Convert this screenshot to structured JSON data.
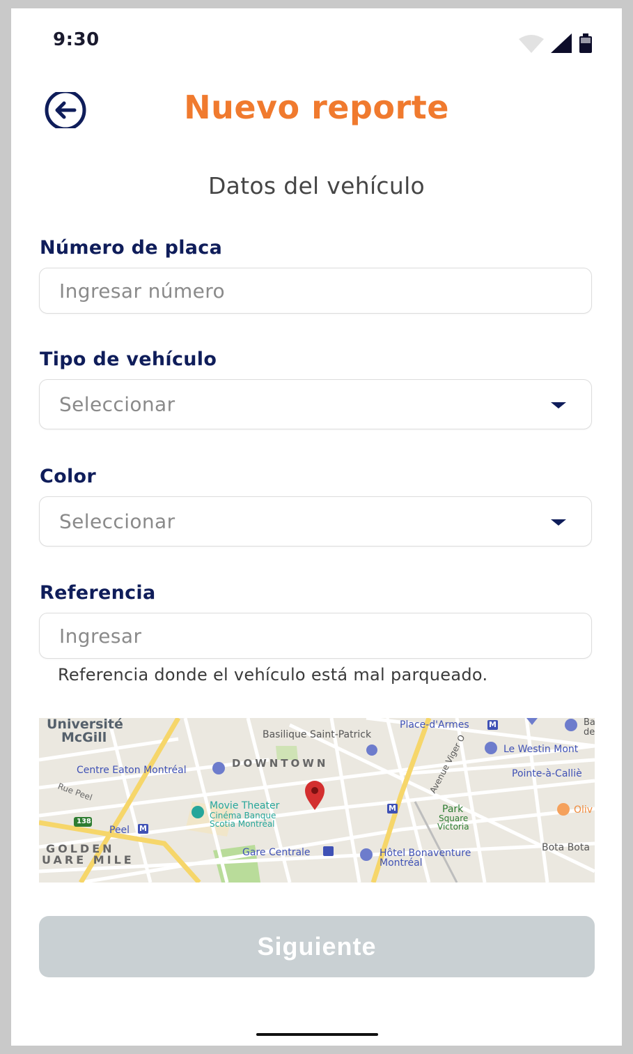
{
  "status_bar": {
    "time": "9:30",
    "icons": [
      "wifi-icon",
      "signal-icon",
      "battery-icon"
    ]
  },
  "header": {
    "back_icon": "back-arrow-circle-icon",
    "title": "Nuevo reporte",
    "title_color": "#f07a2e"
  },
  "section": {
    "title": "Datos del vehículo"
  },
  "form": {
    "plate": {
      "label": "Número de placa",
      "placeholder": "Ingresar número",
      "value": ""
    },
    "vehicle_type": {
      "label": "Tipo de vehículo",
      "selected": "Seleccionar"
    },
    "color": {
      "label": "Color",
      "selected": "Seleccionar"
    },
    "reference": {
      "label": "Referencia",
      "placeholder": "Ingresar",
      "value": "",
      "helper": "Referencia donde el vehículo está mal parqueado."
    }
  },
  "map": {
    "labels": {
      "universite": "Université",
      "mcgill": "McGill",
      "basilique": "Basilique Saint-Patrick",
      "place_darmes": "Place-d'Armes",
      "downtown": "DOWNTOWN",
      "centre_eaton": "Centre Eaton Montréal",
      "le_westin": "Le Westin Mont",
      "pointe": "Pointe-à-Calliè",
      "rue_peel": "Rue Peel",
      "movie_theater": "Movie Theater",
      "cinema1": "Cinéma Banque",
      "cinema2": "Scotia Montréal",
      "park": "Park",
      "square": "Square",
      "victoria": "Victoria",
      "peel": "Peel",
      "route_138": "138",
      "golden": "GOLDEN",
      "square_mile": "UARE MILE",
      "gare_centrale": "Gare Centrale",
      "hotel1": "Hôtel Bonaventure",
      "hotel2": "Montréal",
      "bota": "Bota Bota",
      "avenue_viger": "Avenue Viger O",
      "oliv": "Oliv",
      "ba": "Ba",
      "de": "de",
      "metro": "M"
    },
    "pin_color": "#d32f2f"
  },
  "footer": {
    "next_label": "Siguiente",
    "next_enabled": false
  }
}
